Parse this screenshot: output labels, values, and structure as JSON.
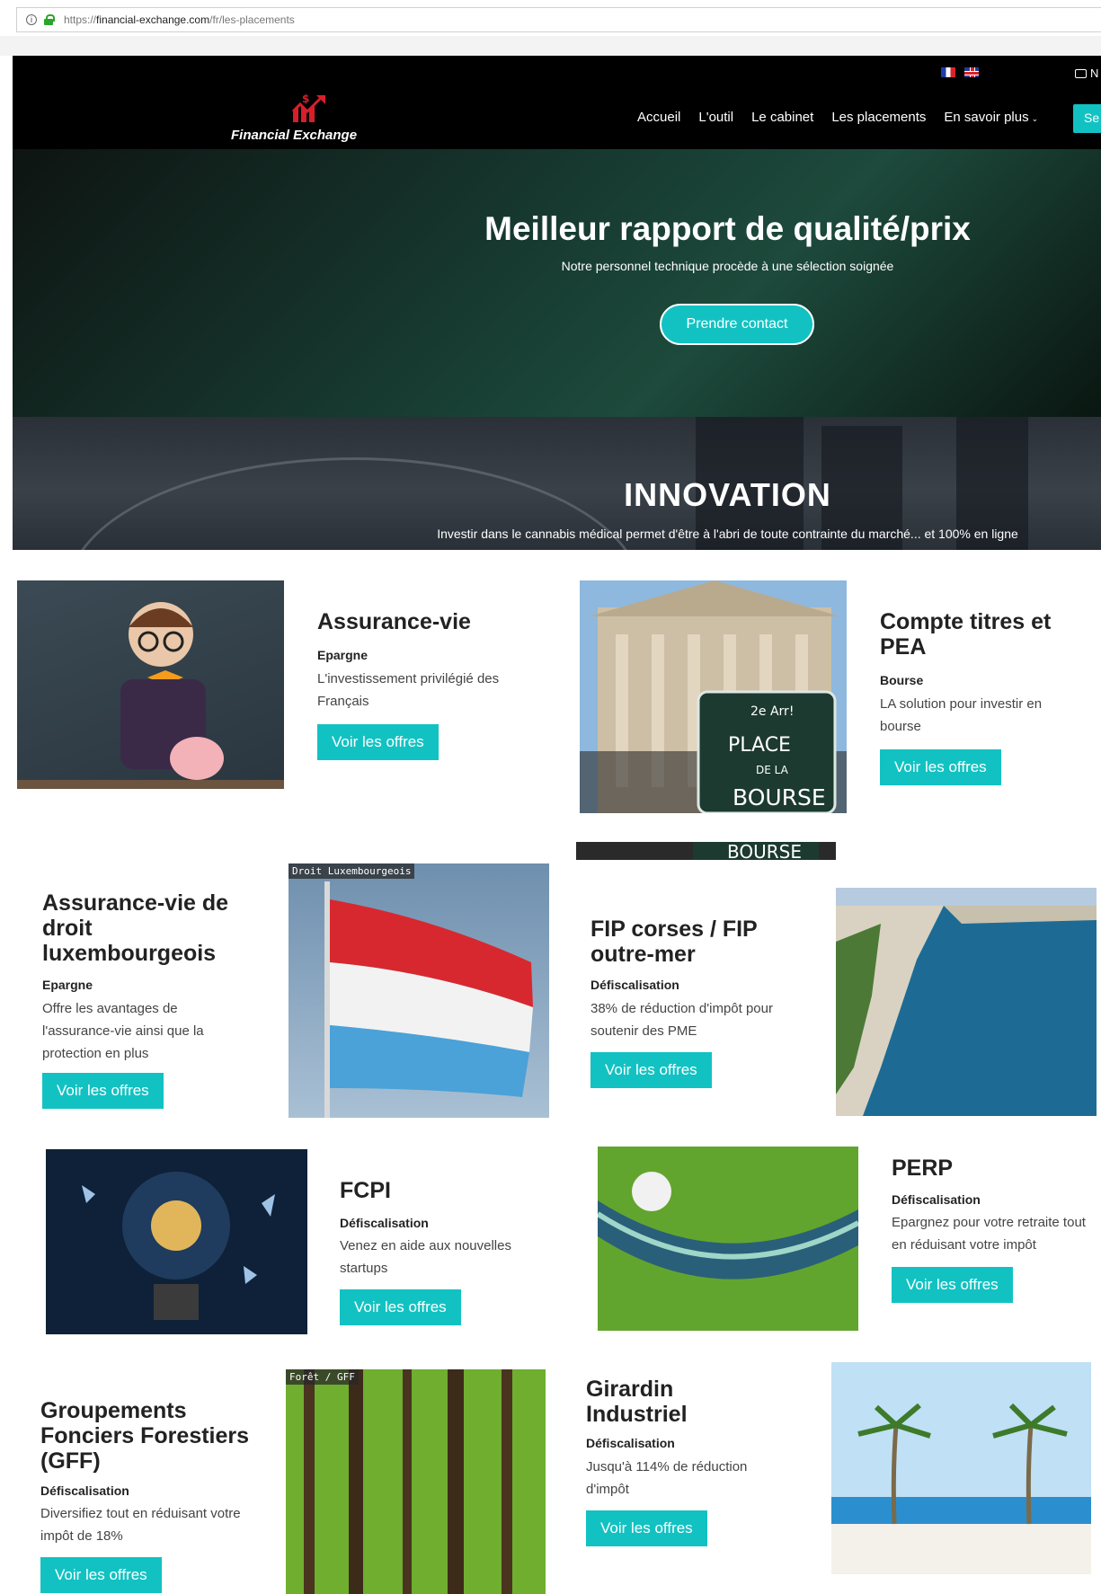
{
  "browser": {
    "url_prefix": "https://",
    "url_host": "financial-exchange.com",
    "url_path": "/fr/les-placements"
  },
  "header": {
    "logo_text": "Financial Exchange",
    "newsletter_label": "N",
    "nav": [
      "Accueil",
      "L'outil",
      "Le cabinet",
      "Les placements",
      "En savoir plus"
    ],
    "connect_label": "Se co"
  },
  "hero": {
    "title": "Meilleur rapport de qualité/prix",
    "subtitle": "Notre personnel technique procède à une sélection soignée",
    "button": "Prendre contact"
  },
  "innovation": {
    "title": "INNOVATION",
    "subtitle": "Investir dans le cannabis médical permet d'être à l'abri de toute contrainte du marché... et 100% en ligne"
  },
  "cards": [
    {
      "title": "Assurance-vie",
      "category": "Epargne",
      "description": "L'investissement privilégié des Français",
      "button": "Voir les offres"
    },
    {
      "title": "Compte titres et PEA",
      "category": "Bourse",
      "description": "LA solution pour investir en bourse",
      "button": "Voir les offres"
    },
    {
      "title": "Assurance-vie de droit luxembourgeois",
      "category": "Epargne",
      "description": "Offre les avantages de l'assurance-vie ainsi que la protection en plus",
      "button": "Voir les offres",
      "image_tag": "Droit Luxembourgeois"
    },
    {
      "title": "FIP corses / FIP outre-mer",
      "category": "Défiscalisation",
      "description": "38% de réduction d'impôt pour soutenir des PME",
      "button": "Voir les offres"
    },
    {
      "title": "FCPI",
      "category": "Défiscalisation",
      "description": "Venez en aide aux nouvelles startups",
      "button": "Voir les offres"
    },
    {
      "title": "PERP",
      "category": "Défiscalisation",
      "description": "Epargnez pour votre retraite tout en réduisant votre impôt",
      "button": "Voir les offres"
    },
    {
      "title": "Groupements Fonciers Forestiers (GFF)",
      "category": "Défiscalisation",
      "description": "Diversifiez tout en réduisant votre impôt de 18%",
      "button": "Voir les offres",
      "image_tag": "Forêt / GFF"
    },
    {
      "title": "Girardin Industriel",
      "category": "Défiscalisation",
      "description": "Jusqu'à 114% de réduction d'impôt",
      "button": "Voir les offres"
    }
  ],
  "images": {
    "bourse_sign_line1": "2e Arr!",
    "bourse_sign_line2": "PLACE",
    "bourse_sign_line3": "DE LA",
    "bourse_sign_line4": "BOURSE",
    "bourse_strip": "BOURSE"
  },
  "colors": {
    "accent": "#12c2c2",
    "header_bg": "#000000",
    "hero_bg": "#1d4a3c"
  }
}
